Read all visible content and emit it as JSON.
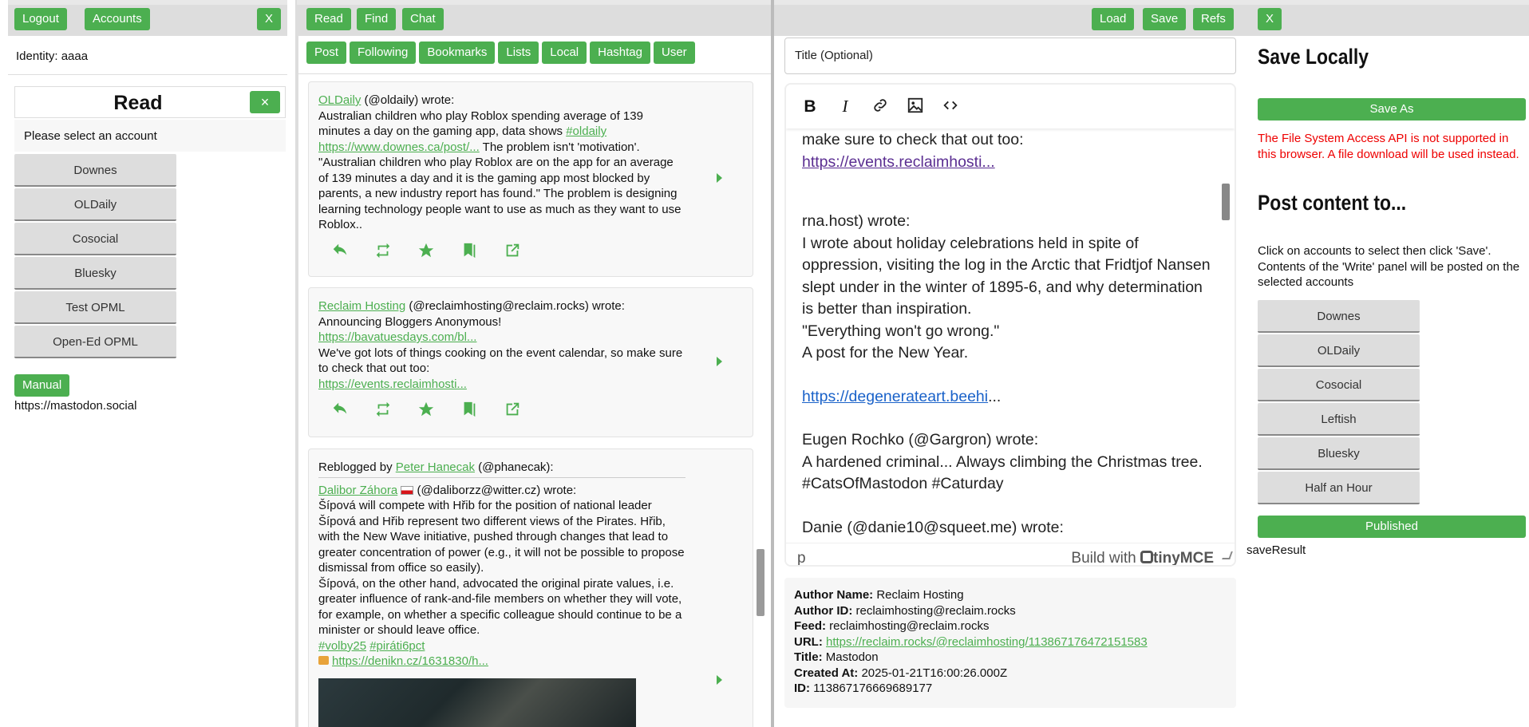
{
  "left": {
    "logout": "Logout",
    "accounts": "Accounts",
    "close": "X",
    "identity": "Identity: aaaa",
    "read_title": "Read",
    "read_close": "×",
    "select_prompt": "Please select an account",
    "accounts_list": [
      "Downes",
      "OLDaily",
      "Cosocial",
      "Bluesky",
      "Test OPML",
      "Open-Ed OPML"
    ],
    "manual": "Manual",
    "server": "https://mastodon.social"
  },
  "reader": {
    "top": {
      "read": "Read",
      "find": "Find",
      "chat": "Chat"
    },
    "tabs": [
      "Post",
      "Following",
      "Bookmarks",
      "Lists",
      "Local",
      "Hashtag",
      "User"
    ],
    "posts": [
      {
        "author_link": "OLDaily",
        "handle": " (@oldaily) wrote:",
        "text1": "Australian children who play Roblox spending average of 139 minutes a day on the gaming app, data shows ",
        "tag": "#oldaily",
        "url": "https://www.downes.ca/post/...",
        "text2": " The problem isn't 'motivation'.",
        "text3": "\"Australian children who play Roblox are on the app for an average of 139 minutes a day and it is the gaming app most blocked by parents, a new industry report has found.\" The problem is designing learning technology people want to use as much as they want to use Roblox.."
      },
      {
        "author_link": "Reclaim Hosting",
        "handle": " (@reclaimhosting@reclaim.rocks) wrote:",
        "text1": "Announcing Bloggers Anonymous!",
        "url1": "https://bavatuesdays.com/bl...",
        "text2": "We've got lots of things cooking on the event calendar, so make sure to check that out too:",
        "url2": "https://events.reclaimhosti..."
      },
      {
        "reblog_prefix": "Reblogged by ",
        "reblogger": "Peter Hanecak",
        "reblog_handle": " (@phanecak):",
        "author_link": "Dalibor Záhora",
        "flag": "🇨🇿",
        "handle": " (@daliborzz@witter.cz) wrote:",
        "p1": "Šípová will compete with Hřib for the position of national leader Šípová and Hřib represent two different views of the Pirates. Hřib, with the New Wave initiative, pushed through changes that lead to greater concentration of power (e.g., it will not be possible to propose dismissal from office so easily).",
        "p2": "Šípová, on the other hand, advocated the original pirate values, i.e. greater influence of rank-and-file members on whether they will vote, for example, on whether a specific colleague should continue to be a minister or should leave office.",
        "tag1": "#volby25",
        "tag2": "#piráti6pct",
        "lock": "🔓",
        "url": "https://denikn.cz/1631830/h..."
      }
    ]
  },
  "editor": {
    "top": {
      "load": "Load",
      "save": "Save",
      "refs": "Refs"
    },
    "title_placeholder": "Title (Optional)",
    "content": {
      "l1": "make sure to check that out too:",
      "link1": "https://events.reclaimhosti...",
      "l2": "rna.host) wrote:",
      "l3": "I wrote about holiday celebrations held in spite of oppression, visiting the log in the Arctic that Fridtjof Nansen slept under in the winter of 1895-6, and why determination is better than inspiration.",
      "l4": "\"Everything won't go wrong.\"",
      "l5": "A post for the New Year.",
      "link2": "https://degenerateart.beehi",
      "link2_tail": "...",
      "l6": "Eugen Rochko (@Gargron) wrote:",
      "l7": "A hardened criminal... Always climbing the Christmas tree. #CatsOfMastodon #Caturday",
      "l8": "Danie (@danie10@squeet.me) wrote:"
    },
    "statusbar_path": "p",
    "branding": "Build with",
    "brand_name": "tinyMCE",
    "meta": {
      "author_name_label": "Author Name:",
      "author_name": " Reclaim Hosting",
      "author_id_label": "Author ID:",
      "author_id": " reclaimhosting@reclaim.rocks",
      "feed_label": "Feed:",
      "feed": " reclaimhosting@reclaim.rocks",
      "url_label": "URL:",
      "url": "https://reclaim.rocks/@reclaimhosting/113867176472151583",
      "title_label": "Title:",
      "title": " Mastodon",
      "created_label": "Created At:",
      "created": " 2025-01-21T16:00:26.000Z",
      "id_label": "ID:",
      "id": " 113867176669689177"
    }
  },
  "right": {
    "close": "X",
    "save_locally": "Save Locally",
    "save_as": "Save As",
    "warning": "The File System Access API is not supported in this browser. A file download will be used instead.",
    "post_content": "Post content to...",
    "instructions": "Click on accounts to select then click 'Save'. Contents of the 'Write' panel will be posted on the selected accounts",
    "accounts": [
      "Downes",
      "OLDaily",
      "Cosocial",
      "Leftish",
      "Bluesky",
      "Half an Hour"
    ],
    "published": "Published",
    "save_result": "saveResult"
  },
  "colors": {
    "accent": "#4caf50",
    "warning": "#ee0000",
    "link_blue": "#1a62c9",
    "link_visited": "#5a2d91"
  },
  "icons": [
    "reply-icon",
    "boost-icon",
    "favorite-icon",
    "bookmark-icon",
    "open-external-icon",
    "bold-icon",
    "italic-icon",
    "link-icon",
    "image-icon",
    "code-icon"
  ]
}
